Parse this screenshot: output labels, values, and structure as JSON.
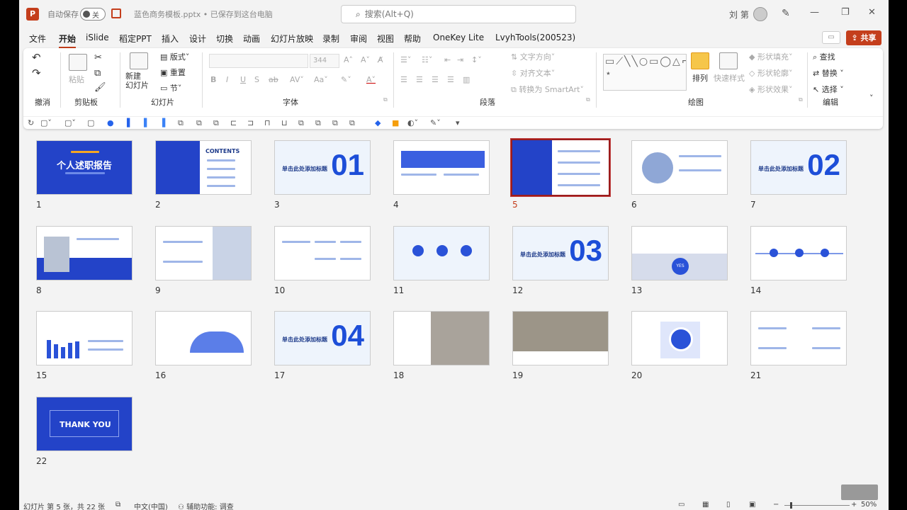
{
  "titlebar": {
    "app_icon": "P",
    "autosave_label": "自动保存",
    "autosave_state": "关",
    "doc_title": "蓝色商务模板.pptx • 已保存到这台电脑",
    "search_placeholder": "搜索(Alt+Q)",
    "user_name": "刘 第"
  },
  "menu": {
    "items": [
      "文件",
      "开始",
      "iSlide",
      "稻定PPT",
      "插入",
      "设计",
      "切换",
      "动画",
      "幻灯片放映",
      "录制",
      "审阅",
      "视图",
      "帮助",
      "OneKey Lite",
      "LvyhTools(200523)"
    ],
    "active": "开始",
    "share": "共享"
  },
  "ribbon": {
    "groups": [
      "撤消",
      "剪贴板",
      "幻灯片",
      "字体",
      "段落",
      "绘图",
      "编辑"
    ],
    "paste": "粘贴",
    "new_slide": "新建\n幻灯片",
    "layout": "版式",
    "reset": "重置",
    "section": "节",
    "font_size": "344",
    "text_direction": "文字方向",
    "align_text": "对齐文本",
    "smartart": "转换为 SmartArt",
    "arrange": "排列",
    "quick_styles": "快速样式",
    "shape_fill": "形状填充",
    "shape_outline": "形状轮廓",
    "shape_effects": "形状效果",
    "find": "查找",
    "replace": "替换",
    "select": "选择"
  },
  "slides": [
    {
      "num": "1",
      "text": "个人述职报告"
    },
    {
      "num": "2",
      "text": "CONTENTS"
    },
    {
      "num": "3",
      "text": "01",
      "sub": "单击此处添加标题"
    },
    {
      "num": "4",
      "text": ""
    },
    {
      "num": "5",
      "text": ""
    },
    {
      "num": "6",
      "text": ""
    },
    {
      "num": "7",
      "text": "02",
      "sub": "单击此处添加标题"
    },
    {
      "num": "8",
      "text": ""
    },
    {
      "num": "9",
      "text": ""
    },
    {
      "num": "10",
      "text": ""
    },
    {
      "num": "11",
      "text": ""
    },
    {
      "num": "12",
      "text": "03",
      "sub": "单击此处添加标题"
    },
    {
      "num": "13",
      "text": "YES"
    },
    {
      "num": "14",
      "text": ""
    },
    {
      "num": "15",
      "text": ""
    },
    {
      "num": "16",
      "text": ""
    },
    {
      "num": "17",
      "text": "04",
      "sub": "单击此处添加标题"
    },
    {
      "num": "18",
      "text": ""
    },
    {
      "num": "19",
      "text": ""
    },
    {
      "num": "20",
      "text": ""
    },
    {
      "num": "21",
      "text": ""
    },
    {
      "num": "22",
      "text": "THANK YOU"
    }
  ],
  "selected_slide": "5",
  "status": {
    "slide_info": "幻灯片 第 5 张，共 22 张",
    "language": "中文(中国)",
    "accessibility": "辅助功能: 调查",
    "zoom": "50%"
  },
  "colors": {
    "accent": "#c43e1c",
    "slide_blue": "#2343c8"
  }
}
